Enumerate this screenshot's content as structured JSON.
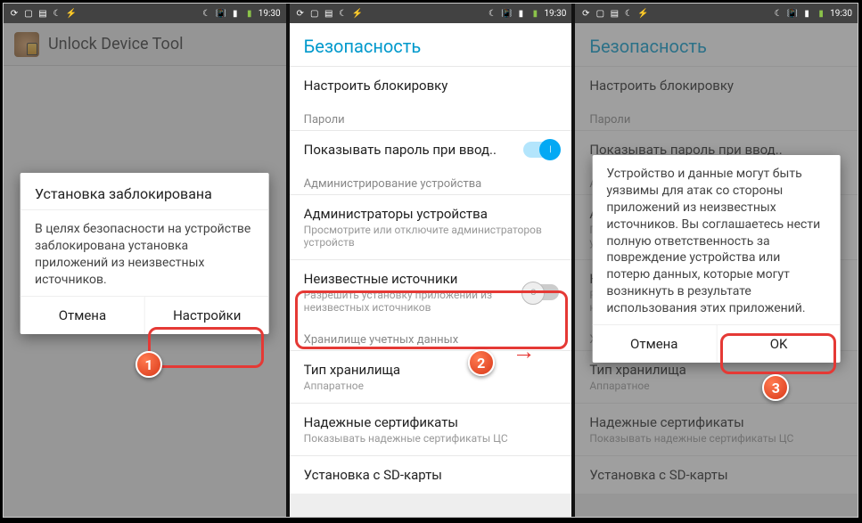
{
  "statusbar": {
    "time": "19:30"
  },
  "screen1": {
    "app_title": "Unlock Device Tool",
    "dialog_title": "Установка заблокирована",
    "dialog_body": "В целях безопасности на устройстве заблокирована установка приложений из неизвестных источников.",
    "cancel": "Отмена",
    "settings": "Настройки",
    "badge": "1"
  },
  "screen2": {
    "header": "Безопасность",
    "lock_setup": "Настроить блокировку",
    "passwords_section": "Пароли",
    "show_pw": "Показывать пароль при ввод..",
    "admin_section": "Администрирование устройства",
    "admins_title": "Администраторы устройства",
    "admins_sub": "Просмотрите или отключите администраторов устройств",
    "unknown_title": "Неизвестные источники",
    "unknown_sub": "Разрешить установку приложений из неизвестных источников",
    "storage_section": "Хранилище учетных данных",
    "storage_type": "Тип хранилища",
    "storage_type_sub": "Аппаратное",
    "certs": "Надежные сертификаты",
    "certs_sub": "Показывать надежные сертификаты ЦС",
    "sdcard": "Установка с SD-карты",
    "badge": "2"
  },
  "screen3": {
    "header": "Безопасность",
    "dialog_body": "Устройство и данные могут быть уязвимы для атак со стороны приложений из неизвестных источников. Вы соглашаетесь нести полную ответственность за повреждение устройства или потерю данных, которые могут возникнуть в результате использования этих приложений.",
    "cancel": "Отмена",
    "ok": "OK",
    "badge": "3"
  }
}
